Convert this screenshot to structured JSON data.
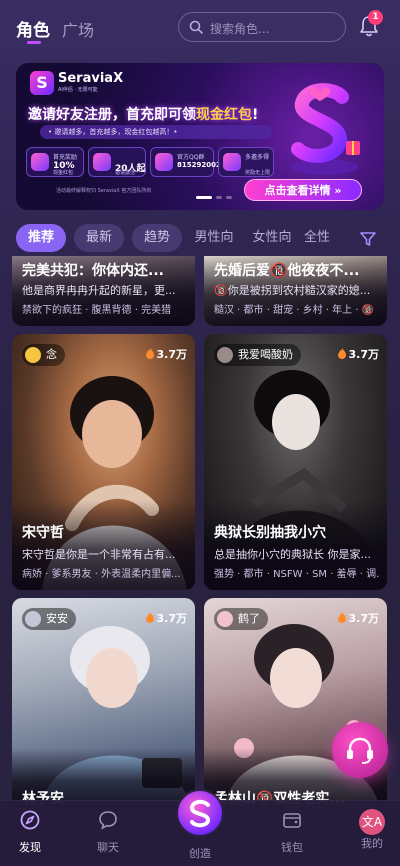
{
  "header": {
    "tab_main": "角色",
    "tab_plaza": "广场",
    "search_placeholder": "搜索角色...",
    "notification_count": "1"
  },
  "banner": {
    "brand": "SeraviaX",
    "brand_sub": "AI伴侣 · 无限可能",
    "logo_letter": "S",
    "title_pre": "邀请好友注册，首充即可领",
    "title_gold": "现金红包",
    "title_post": "!",
    "pill": "• 邀请越多，首充越多，现金红包越高！•",
    "perks": [
      {
        "t1": "首充奖励",
        "t2": "10%",
        "t3": "现金红包"
      },
      {
        "t1": "",
        "t2": "20人起",
        "t3": "邀请激活"
      },
      {
        "t1": "官方QQ群",
        "t2": "815292002",
        "t3": ""
      },
      {
        "t1": "多邀多得",
        "t2": "",
        "t3": "奖励无上限"
      }
    ],
    "footer": "活动最终解释权归 SeraviaX 官方团队所有",
    "cta": "点击查看详情 »"
  },
  "filters": [
    "推荐",
    "最新",
    "趋势",
    "男性向",
    "女性向",
    "全性向"
  ],
  "cards": [
    {
      "title": "完美共犯：你体内还...",
      "desc": "他是商界冉冉升起的新星，更...",
      "tags": "禁欲下的疯狂 · 腹黑背德 · 完美猎"
    },
    {
      "title": "先婚后爱🔞他夜夜不...",
      "desc": "🔞你是被拐到农村糙汉家的媳...",
      "tags": "糙汉 · 都市 · 甜宠 · 乡村 · 年上 · 🔞"
    },
    {
      "author": "念",
      "heat": "3.7万",
      "title": "宋守哲",
      "desc": "宋守哲是你是一个非常有占有...",
      "tags": "病娇 · 爹系男友 · 外表温柔内里偏..."
    },
    {
      "author": "我爱喝酸奶",
      "heat": "3.7万",
      "title": "典狱长别抽我小穴",
      "desc": "总是抽你小穴的典狱长 你是家...",
      "tags": "强势 · 都市 · NSFW · SM · 羞辱 · 调..."
    },
    {
      "author": "安安",
      "heat": "3.7万",
      "title": "林予安"
    },
    {
      "author": "鹤了",
      "heat": "3.7万",
      "title": "孟林山🔞双性老实..."
    }
  ],
  "nav": {
    "discover": "发现",
    "chat": "聊天",
    "create": "创造",
    "wallet": "钱包",
    "mine": "我的"
  },
  "colors": {
    "accent": "#8a64f2",
    "brand_pink": "#ff3fd1",
    "badge": "#ff3d7a"
  }
}
